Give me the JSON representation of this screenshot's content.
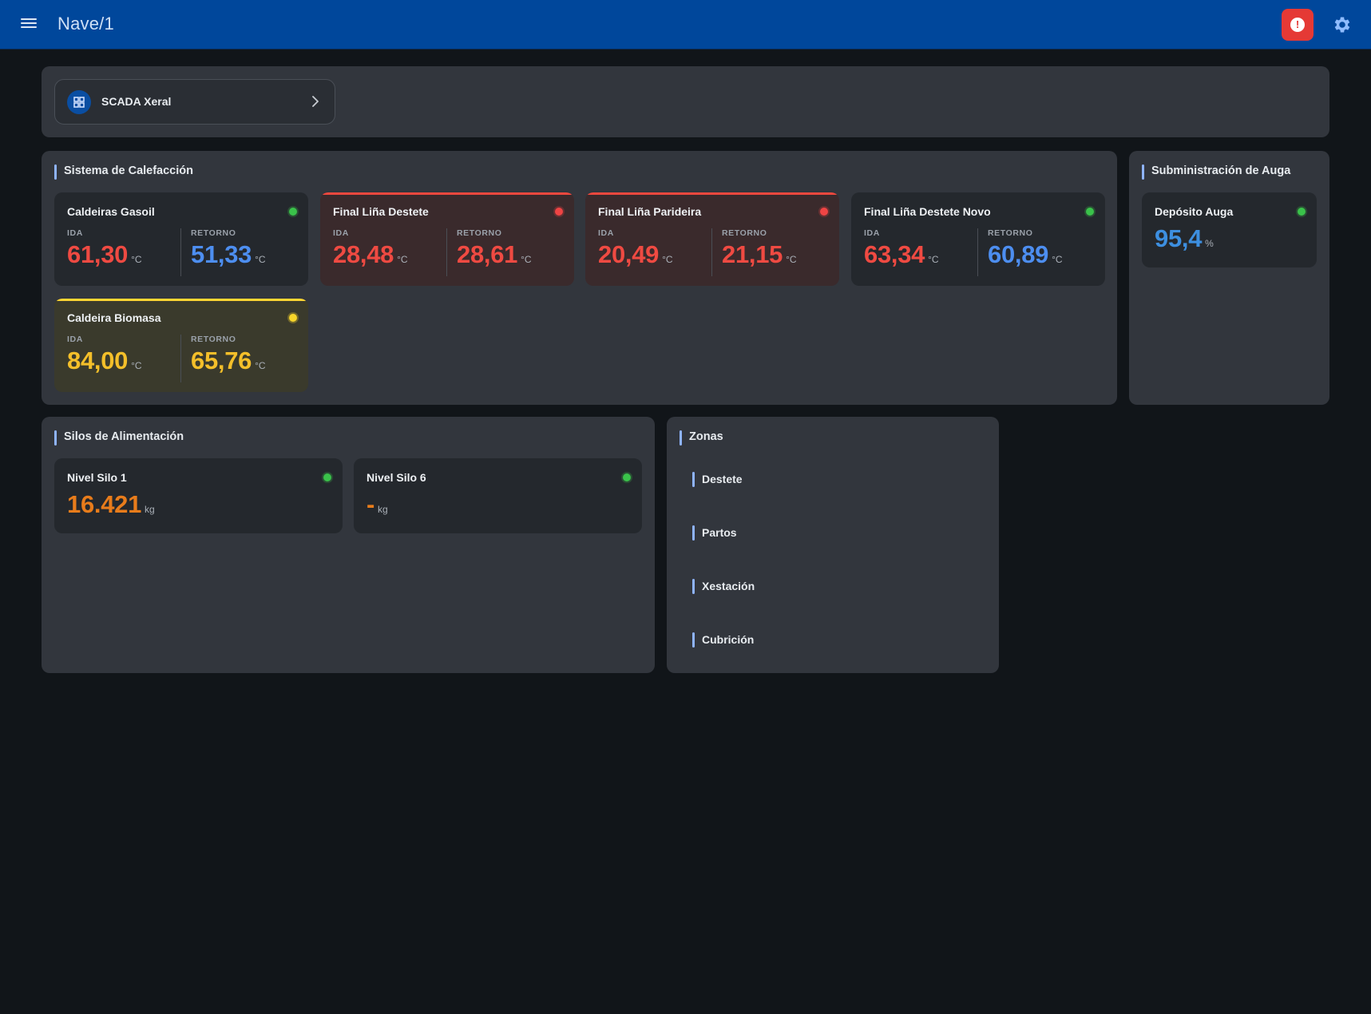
{
  "header": {
    "title": "Nave/1",
    "alert_icon": "alert-circle-icon",
    "settings_icon": "gear-icon",
    "menu_icon": "menu-icon"
  },
  "scada": {
    "label": "SCADA Xeral",
    "icon": "grid-icon"
  },
  "heating": {
    "title": "Sistema de Calefacción",
    "cards": [
      {
        "title": "Caldeiras Gasoil",
        "status": "green",
        "ida_label": "IDA",
        "ida": "61,30",
        "ret_label": "RETORNO",
        "ret": "51,33",
        "unit": "°C"
      },
      {
        "title": "Final Liña Destete",
        "status": "red",
        "ida_label": "IDA",
        "ida": "28,48",
        "ret_label": "RETORNO",
        "ret": "28,61",
        "unit": "°C"
      },
      {
        "title": "Final Liña Parideira",
        "status": "red",
        "ida_label": "IDA",
        "ida": "20,49",
        "ret_label": "RETORNO",
        "ret": "21,15",
        "unit": "°C"
      },
      {
        "title": "Final Liña Destete Novo",
        "status": "green",
        "ida_label": "IDA",
        "ida": "63,34",
        "ret_label": "RETORNO",
        "ret": "60,89",
        "unit": "°C"
      },
      {
        "title": "Caldeira Biomasa",
        "status": "yellow",
        "ida_label": "IDA",
        "ida": "84,00",
        "ret_label": "RETORNO",
        "ret": "65,76",
        "unit": "°C"
      }
    ]
  },
  "water": {
    "title": "Subministración de Auga",
    "card": {
      "title": "Depósito Auga",
      "status": "green",
      "value": "95,4",
      "unit": "%"
    }
  },
  "silos": {
    "title": "Silos de Alimentación",
    "cards": [
      {
        "title": "Nivel Silo 1",
        "status": "green",
        "value": "16.421",
        "unit": "kg"
      },
      {
        "title": "Nivel Silo 6",
        "status": "green",
        "value": "-",
        "unit": "kg"
      }
    ]
  },
  "zones": {
    "title": "Zonas",
    "items": [
      "Destete",
      "Partos",
      "Xestación",
      "Cubrición"
    ]
  },
  "colors": {
    "header": "#00479b",
    "background": "#111519",
    "panel": "#32363d",
    "alert": "#e53935",
    "ok": "#3ac24a",
    "warn": "#f7d52a",
    "error": "#ef4444"
  }
}
